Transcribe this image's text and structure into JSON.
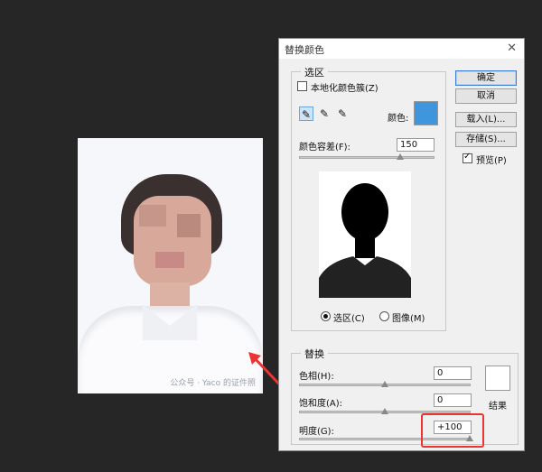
{
  "photo": {
    "watermark": "公众号 · Yaco 的证件照"
  },
  "dialog": {
    "title": "替换颜色",
    "close_glyph": "✕",
    "selection": {
      "legend": "选区",
      "localized_label": "本地化颜色簇(Z)",
      "localized_checked": false,
      "color_label": "颜色:",
      "color_value": "#3f96dc",
      "fuzziness_label": "颜色容差(F):",
      "fuzziness_value": "150",
      "radio_selection_label": "选区(C)",
      "radio_image_label": "图像(M)",
      "radio_selected": "selection"
    },
    "buttons": {
      "ok": "确定",
      "cancel": "取消",
      "load": "载入(L)...",
      "save": "存储(S)..."
    },
    "preview_label": "预览(P)",
    "preview_checked": true,
    "replace": {
      "legend": "替换",
      "hue_label": "色相(H):",
      "hue_value": "0",
      "saturation_label": "饱和度(A):",
      "saturation_value": "0",
      "lightness_label": "明度(G):",
      "lightness_value": "+100",
      "result_label": "结果",
      "result_color": "#ffffff"
    }
  }
}
